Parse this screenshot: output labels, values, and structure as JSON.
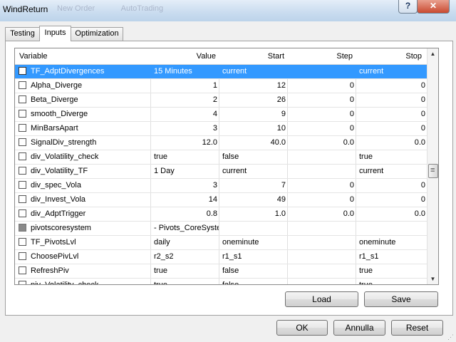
{
  "window": {
    "title": "WindReturn"
  },
  "title_controls": {
    "help": "?",
    "close": "✕"
  },
  "background_toolbar": [
    "New Order",
    "AutoTrading"
  ],
  "tabs": [
    "Testing",
    "Inputs",
    "Optimization"
  ],
  "active_tab": "Inputs",
  "columns": [
    "Variable",
    "Value",
    "Start",
    "Step",
    "Stop"
  ],
  "rows": [
    {
      "name": "TF_AdptDivergences",
      "value": "15 Minutes",
      "start": "current",
      "step": "",
      "stop": "current",
      "align": "text",
      "selected": true
    },
    {
      "name": "Alpha_Diverge",
      "value": "1",
      "start": "12",
      "step": "0",
      "stop": "0",
      "align": "num"
    },
    {
      "name": "Beta_Diverge",
      "value": "2",
      "start": "26",
      "step": "0",
      "stop": "0",
      "align": "num"
    },
    {
      "name": "smooth_Diverge",
      "value": "4",
      "start": "9",
      "step": "0",
      "stop": "0",
      "align": "num"
    },
    {
      "name": "MinBarsApart",
      "value": "3",
      "start": "10",
      "step": "0",
      "stop": "0",
      "align": "num"
    },
    {
      "name": "SignalDiv_strength",
      "value": "12.0",
      "start": "40.0",
      "step": "0.0",
      "stop": "0.0",
      "align": "num"
    },
    {
      "name": "div_Volatility_check",
      "value": "true",
      "start": "false",
      "step": "",
      "stop": "true",
      "align": "text"
    },
    {
      "name": "div_Volatility_TF",
      "value": "1 Day",
      "start": "current",
      "step": "",
      "stop": "current",
      "align": "text"
    },
    {
      "name": "div_spec_Vola",
      "value": "3",
      "start": "7",
      "step": "0",
      "stop": "0",
      "align": "num"
    },
    {
      "name": "div_Invest_Vola",
      "value": "14",
      "start": "49",
      "step": "0",
      "stop": "0",
      "align": "num"
    },
    {
      "name": "div_AdptTrigger",
      "value": "0.8",
      "start": "1.0",
      "step": "0.0",
      "stop": "0.0",
      "align": "num"
    },
    {
      "name": "pivotscoresystem",
      "value": "- Pivots_CoreSystem -",
      "start": "",
      "step": "",
      "stop": "",
      "align": "text",
      "disabled": true
    },
    {
      "name": "TF_PivotsLvl",
      "value": "daily",
      "start": "oneminute",
      "step": "",
      "stop": "oneminute",
      "align": "text"
    },
    {
      "name": "ChoosePivLvl",
      "value": "r2_s2",
      "start": "r1_s1",
      "step": "",
      "stop": "r1_s1",
      "align": "text"
    },
    {
      "name": "RefreshPiv",
      "value": "true",
      "start": "false",
      "step": "",
      "stop": "true",
      "align": "text"
    },
    {
      "name": "piv_Volatility_check",
      "value": "true",
      "start": "false",
      "step": "",
      "stop": "true",
      "align": "text"
    }
  ],
  "buttons": {
    "load": "Load",
    "save": "Save",
    "ok": "OK",
    "cancel": "Annulla",
    "reset": "Reset"
  },
  "colors": {
    "selection": "#3399ff",
    "close": "#c94a30"
  }
}
